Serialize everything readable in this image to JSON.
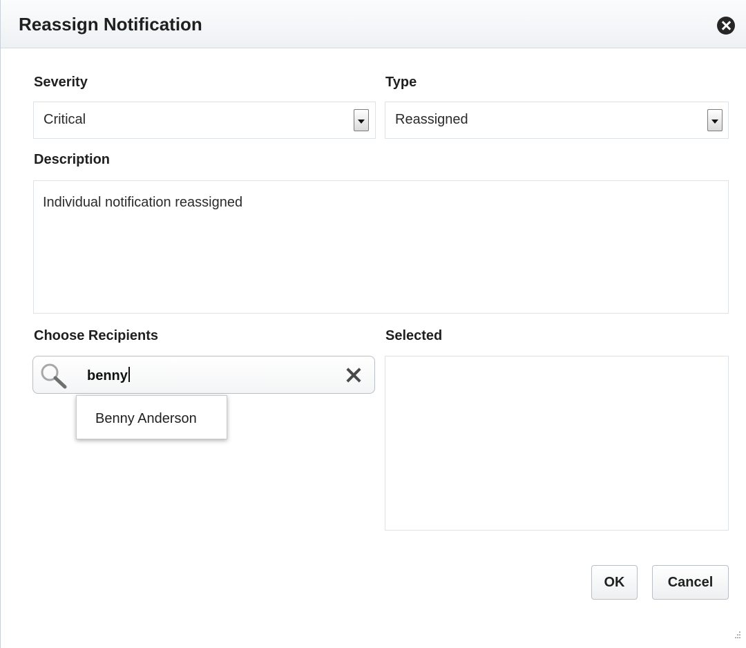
{
  "dialog": {
    "title": "Reassign Notification",
    "close_icon": "close-circle-icon"
  },
  "form": {
    "severity": {
      "label": "Severity",
      "value": "Critical"
    },
    "type": {
      "label": "Type",
      "value": "Reassigned"
    },
    "description": {
      "label": "Description",
      "value": "Individual notification reassigned"
    },
    "recipients": {
      "label": "Choose Recipients",
      "search_value": "benny",
      "search_icon": "magnifier-icon",
      "clear_icon": "clear-x-icon",
      "suggestions": [
        "Benny Anderson"
      ]
    },
    "selected": {
      "label": "Selected",
      "items": []
    }
  },
  "actions": {
    "ok_label": "OK",
    "cancel_label": "Cancel"
  },
  "colors": {
    "title_bg": "#eef1f4",
    "border": "#dde2e6",
    "text": "#1f1f1f"
  }
}
